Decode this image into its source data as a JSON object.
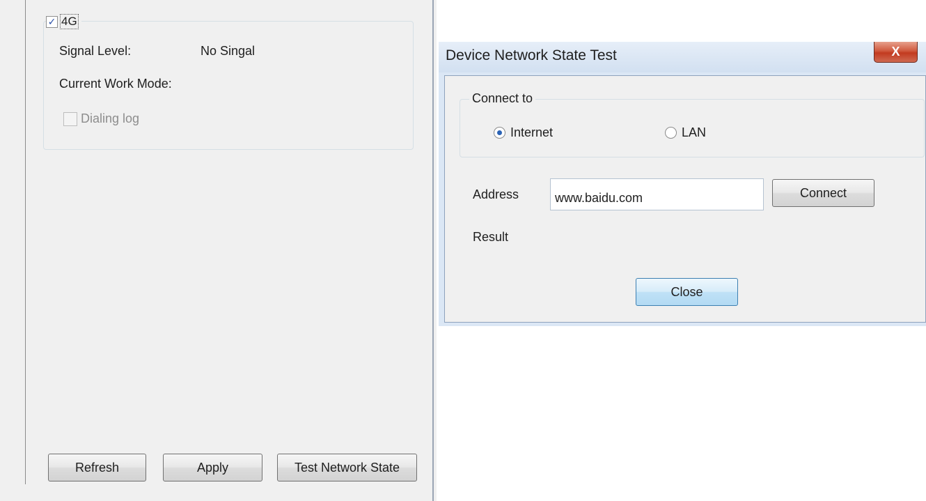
{
  "left_panel": {
    "group": {
      "checkbox_checked": true,
      "title": "4G",
      "signal_level_label": "Signal Level:",
      "signal_level_value": "No Singal",
      "work_mode_label": "Current Work Mode:",
      "dialing_log_label": "Dialing log",
      "dialing_log_checked": false
    },
    "buttons": {
      "refresh": "Refresh",
      "apply": "Apply",
      "test_network_state": "Test Network State"
    }
  },
  "dialog": {
    "title": "Device Network State Test",
    "close_glyph": "X",
    "connect_to": {
      "label": "Connect to",
      "options": [
        {
          "label": "Internet",
          "checked": true
        },
        {
          "label": "LAN",
          "checked": false
        }
      ]
    },
    "address_label": "Address",
    "address_value": "www.baidu.com",
    "connect_button": "Connect",
    "result_label": "Result",
    "close_button": "Close"
  },
  "icons": {
    "checkmark": "checkmark-icon",
    "radio_selected": "radio-selected-icon",
    "window_close": "close-icon"
  },
  "colors": {
    "window_background": "#f0f0f0",
    "titlebar": "#d2e0f1",
    "close_button_red": "#c23a1f",
    "focused_button": "#bfe1f6",
    "radio_dot": "#2b63b5"
  }
}
